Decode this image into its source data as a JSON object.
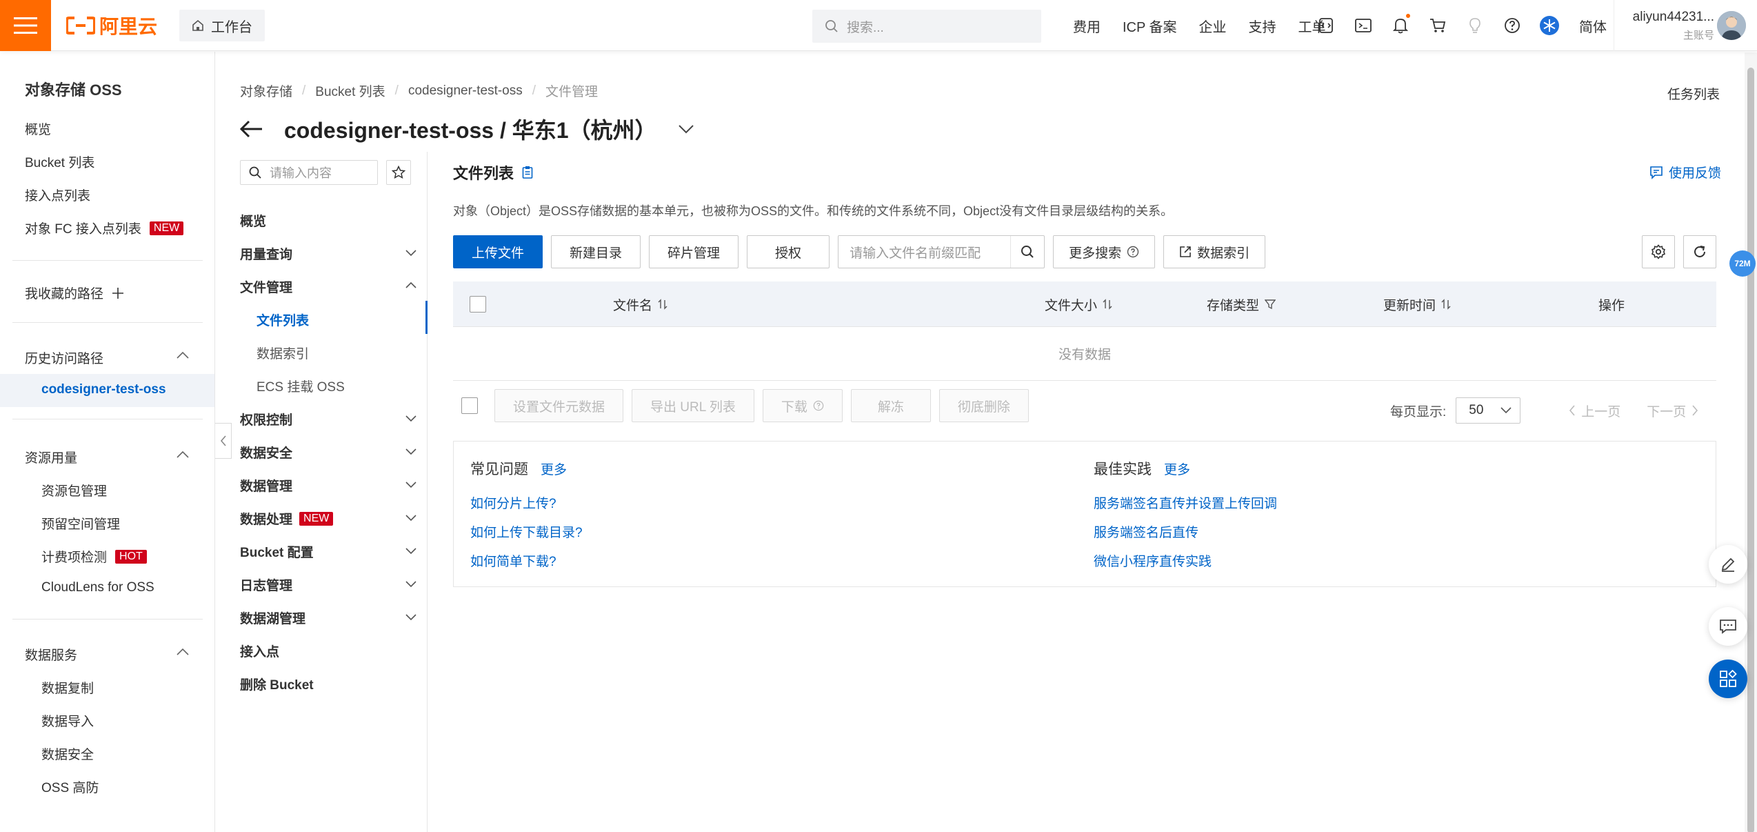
{
  "topbar": {
    "logo_text": "阿里云",
    "workbench": "工作台",
    "search_placeholder": "搜索...",
    "links": [
      "费用",
      "ICP 备案",
      "企业",
      "支持",
      "工单"
    ],
    "language": "简体",
    "account_name": "aliyun44231...",
    "account_role": "主账号",
    "brand_color": "#ff6a00"
  },
  "sidebar": {
    "title": "对象存储 OSS",
    "items": [
      "概览",
      "Bucket 列表",
      "接入点列表",
      "对象 FC 接入点列表"
    ],
    "fc_badge": "NEW",
    "favorites": "我收藏的路径",
    "history_title": "历史访问路径",
    "history_active": "codesigner-test-oss",
    "resource_title": "资源用量",
    "resource_items": [
      "资源包管理",
      "预留空间管理",
      "计费项检测",
      "CloudLens for OSS"
    ],
    "hot_badge": "HOT",
    "data_service_title": "数据服务",
    "data_service_items": [
      "数据复制",
      "数据导入",
      "数据安全",
      "OSS 高防"
    ]
  },
  "header": {
    "breadcrumb": [
      "对象存储",
      "Bucket 列表",
      "codesigner-test-oss",
      "文件管理"
    ],
    "title": "codesigner-test-oss / 华东1（杭州）",
    "task_list": "任务列表"
  },
  "bucket_nav": {
    "search_placeholder": "请输入内容",
    "overview": "概览",
    "usage": "用量查询",
    "file_mgmt": "文件管理",
    "file_list": "文件列表",
    "data_index": "数据索引",
    "ecs_mount": "ECS 挂载 OSS",
    "permission": "权限控制",
    "data_security": "数据安全",
    "data_mgmt": "数据管理",
    "data_processing": "数据处理",
    "processing_badge": "NEW",
    "bucket_config": "Bucket 配置",
    "log_mgmt": "日志管理",
    "data_lake": "数据湖管理",
    "access_point": "接入点",
    "delete_bucket": "删除 Bucket"
  },
  "main": {
    "title": "文件列表",
    "feedback": "使用反馈",
    "description": "对象（Object）是OSS存储数据的基本单元，也被称为OSS的文件。和传统的文件系统不同，Object没有文件目录层级结构的关系。",
    "toolbar": {
      "upload": "上传文件",
      "new_dir": "新建目录",
      "fragments": "碎片管理",
      "authorize": "授权",
      "search_placeholder": "请输入文件名前缀匹配",
      "more_search": "更多搜索",
      "data_index": "数据索引"
    },
    "columns": {
      "name": "文件名",
      "size": "文件大小",
      "storage_type": "存储类型",
      "updated": "更新时间",
      "actions": "操作"
    },
    "empty_text": "没有数据",
    "batch": {
      "set_meta": "设置文件元数据",
      "export_url": "导出 URL 列表",
      "download": "下载",
      "unfreeze": "解冻",
      "delete": "彻底删除"
    },
    "pager": {
      "per_page_label": "每页显示:",
      "per_page_value": "50",
      "prev": "上一页",
      "next": "下一页"
    },
    "faq": {
      "title": "常见问题",
      "more": "更多",
      "links": [
        "如何分片上传?",
        "如何上传下载目录?",
        "如何简单下载?"
      ]
    },
    "best_practice": {
      "title": "最佳实践",
      "more": "更多",
      "links": [
        "服务端签名直传并设置上传回调",
        "服务端签名后直传",
        "微信小程序直传实践"
      ]
    }
  },
  "floating": {
    "memory_badge": "72M"
  },
  "accent_color": "#0064c8"
}
